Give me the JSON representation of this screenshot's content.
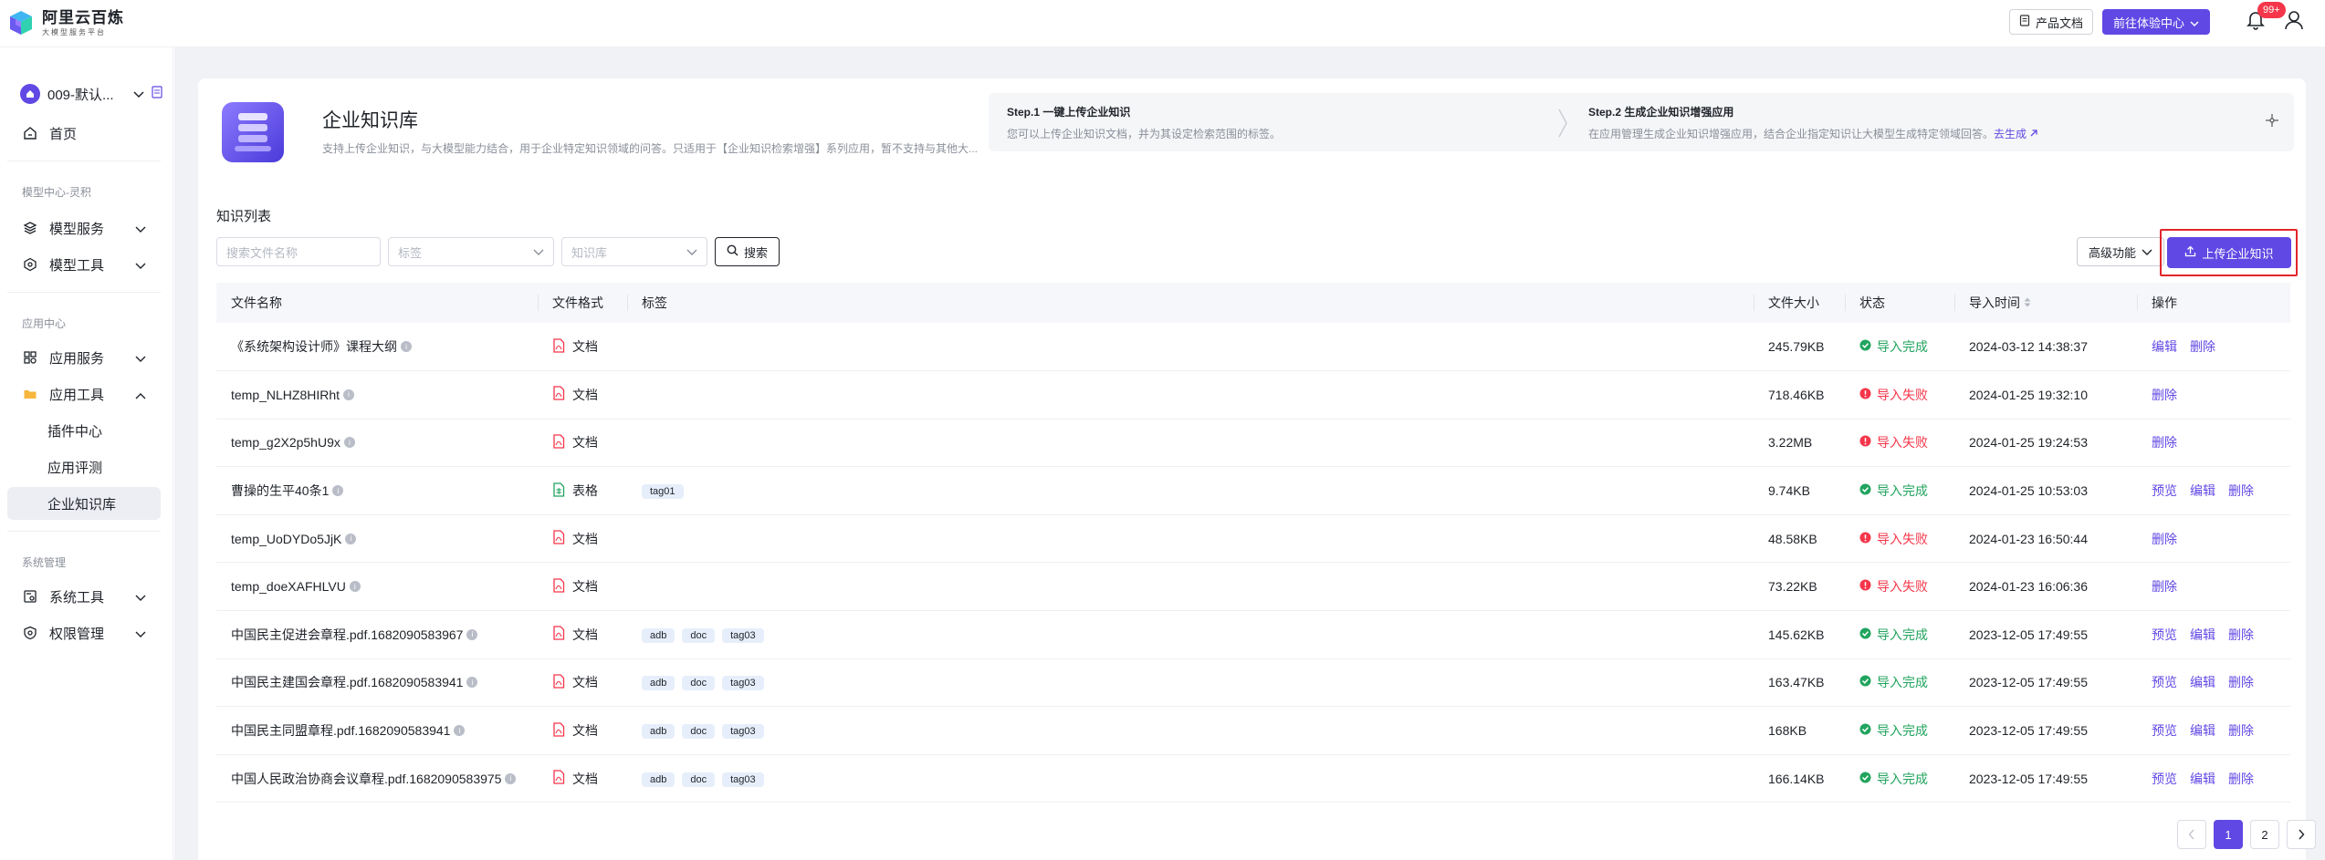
{
  "brand": {
    "name": "阿里云百炼",
    "subtitle": "大模型服务平台"
  },
  "topbar": {
    "doc_label": "产品文档",
    "experience_label": "前往体验中心",
    "notification_badge": "99+"
  },
  "sidebar": {
    "workspace": "009-默认...",
    "home": "首页",
    "group_model": "模型中心-灵积",
    "model_service": "模型服务",
    "model_tools": "模型工具",
    "group_app": "应用中心",
    "app_service": "应用服务",
    "app_tools": "应用工具",
    "sub_items": [
      "插件中心",
      "应用评测",
      "企业知识库"
    ],
    "group_system": "系统管理",
    "system_tools": "系统工具",
    "permission": "权限管理"
  },
  "hero": {
    "title": "企业知识库",
    "description": "支持上传企业知识，与大模型能力结合，用于企业特定知识领域的问答。只适用于【企业知识检索增强】系列应用，暂不支持与其他大...",
    "step1_title": "Step.1 一键上传企业知识",
    "step1_desc": "您可以上传企业知识文档，并为其设定检索范围的标签。",
    "step2_title": "Step.2 生成企业知识增强应用",
    "step2_desc": "在应用管理生成企业知识增强应用，结合企业指定知识让大模型生成特定领域回答。",
    "step2_link": "去生成"
  },
  "list": {
    "title": "知识列表",
    "search_placeholder": "搜索文件名称",
    "tag_placeholder": "标签",
    "kb_placeholder": "知识库",
    "search_button": "搜索",
    "advanced_button": "高级功能",
    "upload_button": "上传企业知识",
    "columns": [
      "文件名称",
      "文件格式",
      "标签",
      "文件大小",
      "状态",
      "导入时间",
      "操作"
    ],
    "rows": [
      {
        "name": "《系统架构设计师》课程大纲",
        "format": "文档",
        "fmt_type": "pdf",
        "tags": [],
        "size": "245.79KB",
        "status": "导入完成",
        "ok": true,
        "time": "2024-03-12 14:38:37",
        "ops": [
          "编辑",
          "删除"
        ]
      },
      {
        "name": "temp_NLHZ8HIRht",
        "format": "文档",
        "fmt_type": "pdf",
        "tags": [],
        "size": "718.46KB",
        "status": "导入失败",
        "ok": false,
        "time": "2024-01-25 19:32:10",
        "ops": [
          "删除"
        ]
      },
      {
        "name": "temp_g2X2p5hU9x",
        "format": "文档",
        "fmt_type": "pdf",
        "tags": [],
        "size": "3.22MB",
        "status": "导入失败",
        "ok": false,
        "time": "2024-01-25 19:24:53",
        "ops": [
          "删除"
        ]
      },
      {
        "name": "曹操的生平40条1",
        "format": "表格",
        "fmt_type": "sheet",
        "tags": [
          "tag01"
        ],
        "size": "9.74KB",
        "status": "导入完成",
        "ok": true,
        "time": "2024-01-25 10:53:03",
        "ops": [
          "预览",
          "编辑",
          "删除"
        ]
      },
      {
        "name": "temp_UoDYDo5JjK",
        "format": "文档",
        "fmt_type": "pdf",
        "tags": [],
        "size": "48.58KB",
        "status": "导入失败",
        "ok": false,
        "time": "2024-01-23 16:50:44",
        "ops": [
          "删除"
        ]
      },
      {
        "name": "temp_doeXAFHLVU",
        "format": "文档",
        "fmt_type": "pdf",
        "tags": [],
        "size": "73.22KB",
        "status": "导入失败",
        "ok": false,
        "time": "2024-01-23 16:06:36",
        "ops": [
          "删除"
        ]
      },
      {
        "name": "中国民主促进会章程.pdf.1682090583967",
        "format": "文档",
        "fmt_type": "pdf",
        "tags": [
          "adb",
          "doc",
          "tag03"
        ],
        "size": "145.62KB",
        "status": "导入完成",
        "ok": true,
        "time": "2023-12-05 17:49:55",
        "ops": [
          "预览",
          "编辑",
          "删除"
        ]
      },
      {
        "name": "中国民主建国会章程.pdf.1682090583941",
        "format": "文档",
        "fmt_type": "pdf",
        "tags": [
          "adb",
          "doc",
          "tag03"
        ],
        "size": "163.47KB",
        "status": "导入完成",
        "ok": true,
        "time": "2023-12-05 17:49:55",
        "ops": [
          "预览",
          "编辑",
          "删除"
        ]
      },
      {
        "name": "中国民主同盟章程.pdf.1682090583941",
        "format": "文档",
        "fmt_type": "pdf",
        "tags": [
          "adb",
          "doc",
          "tag03"
        ],
        "size": "168KB",
        "status": "导入完成",
        "ok": true,
        "time": "2023-12-05 17:49:55",
        "ops": [
          "预览",
          "编辑",
          "删除"
        ]
      },
      {
        "name": "中国人民政治协商会议章程.pdf.1682090583975",
        "format": "文档",
        "fmt_type": "pdf",
        "tags": [
          "adb",
          "doc",
          "tag03"
        ],
        "size": "166.14KB",
        "status": "导入完成",
        "ok": true,
        "time": "2023-12-05 17:49:55",
        "ops": [
          "预览",
          "编辑",
          "删除"
        ]
      }
    ],
    "pagination": {
      "pages": [
        "1",
        "2"
      ],
      "current": "1"
    }
  },
  "colors": {
    "accent": "#6048e4",
    "success": "#21a45e",
    "error": "#f5364a",
    "highlight_frame": "#e3262b"
  }
}
